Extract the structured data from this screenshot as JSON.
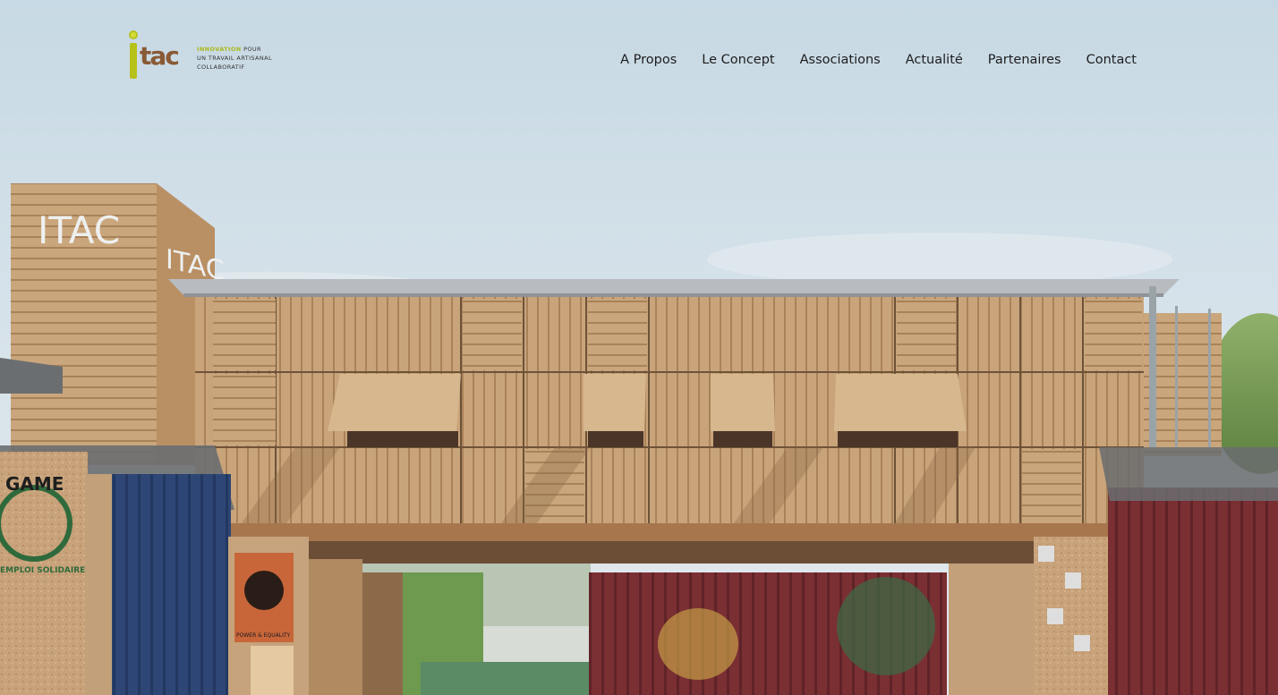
{
  "logo": {
    "mark_letters": "tac",
    "line1_highlight": "INNOVATION",
    "line1_rest": "POUR",
    "line2": "UN TRAVAIL ARTISANAL",
    "line3": "COLLABORATIF"
  },
  "nav": {
    "items": [
      {
        "label": "A Propos"
      },
      {
        "label": "Le Concept"
      },
      {
        "label": "Associations"
      },
      {
        "label": "Actualité"
      },
      {
        "label": "Partenaires"
      },
      {
        "label": "Contact"
      }
    ]
  },
  "hero": {
    "container_sign_front": "ITAC",
    "container_sign_side": "ITAC",
    "left_badge": "GAME",
    "left_badge_sub": "EMPLOI SOLIDAIRE",
    "poster_caption": "POWER & EQUALITY"
  },
  "colors": {
    "nav_text": "#1d1d1d",
    "logo_green": "#b6c21a",
    "logo_brown": "#8a5a35",
    "wood": "#c9a47a"
  }
}
